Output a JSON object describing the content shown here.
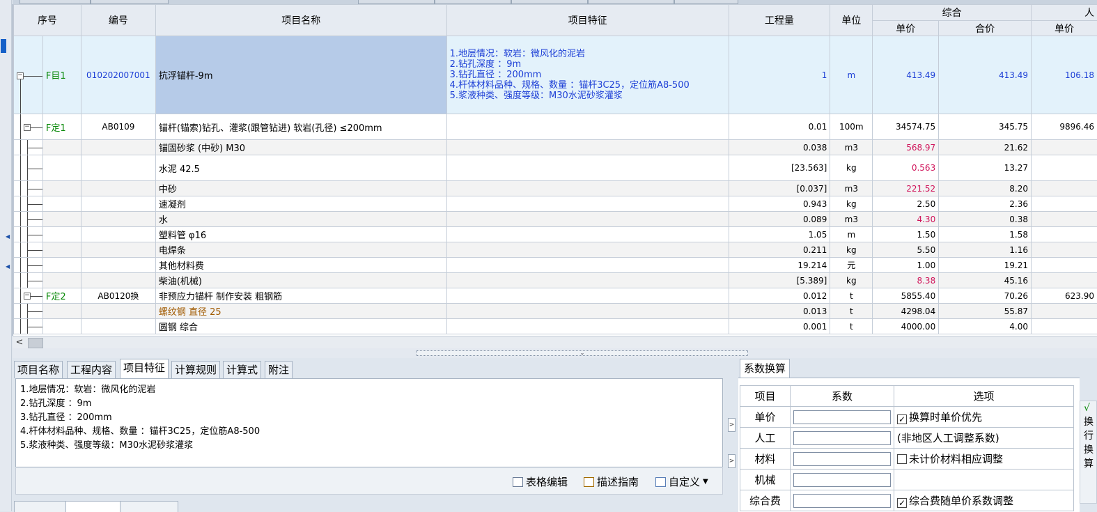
{
  "grid": {
    "headers": {
      "seq": "序号",
      "code": "编号",
      "name": "项目名称",
      "feature": "项目特征",
      "quantity": "工程量",
      "unit": "单位",
      "comprehensive": "综合",
      "comp_unit_price": "单价",
      "comp_total": "合价",
      "labor": "人",
      "labor_unit_price": "单价"
    },
    "item": {
      "label": "F目1",
      "code": "010202007001",
      "name": "抗浮锚杆-9m",
      "features": [
        "1.地层情况：软岩：微风化的泥岩",
        "2.钻孔深度 ：9m",
        "3.钻孔直径 ：200mm",
        "4.杆体材料品种、规格、数量 ：锚杆3C25，定位筋A8-500",
        "5.浆液种类、强度等级：M30水泥砂浆灌浆"
      ],
      "quantity": "1",
      "unit": "m",
      "unit_price": "413.49",
      "total": "413.49",
      "labor_price": "106.18"
    },
    "rows": [
      {
        "label": "F定1",
        "code": "AB0109",
        "name": "锚杆(锚索)钻孔、灌浆(跟管钻进) 软岩(孔径) ≤200mm",
        "quantity": "0.01",
        "unit": "100m",
        "unit_price": "34574.75",
        "total": "345.75",
        "labor": "9896.46",
        "kind": "quota"
      },
      {
        "label": "",
        "code": "",
        "name": "锚固砂浆 (中砂) M30",
        "quantity": "0.038",
        "unit": "m3",
        "unit_price": "568.97",
        "total": "21.62",
        "labor": "",
        "kind": "pink"
      },
      {
        "label": "",
        "code": "",
        "name": "水泥 42.5",
        "quantity": "[23.563]",
        "unit": "kg",
        "unit_price": "0.563",
        "total": "13.27",
        "labor": "",
        "kind": "pink"
      },
      {
        "label": "",
        "code": "",
        "name": "中砂",
        "quantity": "[0.037]",
        "unit": "m3",
        "unit_price": "221.52",
        "total": "8.20",
        "labor": "",
        "kind": "pink"
      },
      {
        "label": "",
        "code": "",
        "name": "速凝剂",
        "quantity": "0.943",
        "unit": "kg",
        "unit_price": "2.50",
        "total": "2.36",
        "labor": "",
        "kind": "normal"
      },
      {
        "label": "",
        "code": "",
        "name": "水",
        "quantity": "0.089",
        "unit": "m3",
        "unit_price": "4.30",
        "total": "0.38",
        "labor": "",
        "kind": "pink"
      },
      {
        "label": "",
        "code": "",
        "name": "塑料管 φ16",
        "quantity": "1.05",
        "unit": "m",
        "unit_price": "1.50",
        "total": "1.58",
        "labor": "",
        "kind": "normal"
      },
      {
        "label": "",
        "code": "",
        "name": "电焊条",
        "quantity": "0.211",
        "unit": "kg",
        "unit_price": "5.50",
        "total": "1.16",
        "labor": "",
        "kind": "normal"
      },
      {
        "label": "",
        "code": "",
        "name": "其他材料费",
        "quantity": "19.214",
        "unit": "元",
        "unit_price": "1.00",
        "total": "19.21",
        "labor": "",
        "kind": "normal"
      },
      {
        "label": "",
        "code": "",
        "name": "柴油(机械)",
        "quantity": "[5.389]",
        "unit": "kg",
        "unit_price": "8.38",
        "total": "45.16",
        "labor": "",
        "kind": "pink"
      },
      {
        "label": "F定2",
        "code": "AB0120换",
        "name": "非预应力锚杆 制作安装 粗钢筋",
        "quantity": "0.012",
        "unit": "t",
        "unit_price": "5855.40",
        "total": "70.26",
        "labor": "623.90",
        "kind": "quota"
      },
      {
        "label": "",
        "code": "",
        "name": "螺纹钢 直径 25",
        "quantity": "0.013",
        "unit": "t",
        "unit_price": "4298.04",
        "total": "55.87",
        "labor": "",
        "kind": "brown"
      },
      {
        "label": "",
        "code": "",
        "name": "圆钢 综合",
        "quantity": "0.001",
        "unit": "t",
        "unit_price": "4000.00",
        "total": "4.00",
        "labor": "",
        "kind": "normal"
      }
    ]
  },
  "bottom_tabs": [
    "项目名称",
    "工程内容",
    "项目特征",
    "计算规则",
    "计算式",
    "附注"
  ],
  "feature_text": [
    "1.地层情况：软岩：微风化的泥岩",
    "2.钻孔深度 ：9m",
    "3.钻孔直径 ：200mm",
    "4.杆体材料品种、规格、数量 ：锚杆3C25，定位筋A8-500",
    "5.浆液种类、强度等级：M30水泥砂浆灌浆"
  ],
  "tools": {
    "table_edit": "表格编辑",
    "guide": "描述指南",
    "custom": "自定义"
  },
  "coef": {
    "tab": "系数换算",
    "headers": {
      "item": "项目",
      "coef": "系数",
      "option": "选项"
    },
    "rows": [
      {
        "label": "单价",
        "option": "换算时单价优先",
        "checkbox": true,
        "checked": true
      },
      {
        "label": "人工",
        "option": "(非地区人工调整系数)",
        "checkbox": false,
        "checked": false
      },
      {
        "label": "材料",
        "option": "未计价材料相应调整",
        "checkbox": true,
        "checked": false
      },
      {
        "label": "机械",
        "option": "",
        "checkbox": false,
        "checked": false
      },
      {
        "label": "综合费",
        "option": "综合费随单价系数调整",
        "checkbox": true,
        "checked": true
      }
    ],
    "side_text": [
      "√",
      "换",
      "行",
      "换",
      "算"
    ]
  },
  "colors": {
    "pink": "#d0145a",
    "brown": "#a05a00",
    "blue": "#1d3fd6",
    "green": "#0a8a0a"
  }
}
